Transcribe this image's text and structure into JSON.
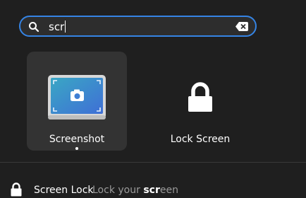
{
  "search": {
    "query": "scr",
    "placeholder": ""
  },
  "apps": [
    {
      "label": "Screenshot",
      "icon": "screenshot-icon",
      "selected": true,
      "running": true
    },
    {
      "label": "Lock Screen",
      "icon": "lock-icon",
      "selected": false,
      "running": false
    }
  ],
  "results": [
    {
      "title": "Screen Lock",
      "description_prefix": "Lock your ",
      "description_match": "scr",
      "description_suffix": "een",
      "icon": "lock-icon"
    }
  ],
  "colors": {
    "accent": "#3584e4",
    "background": "#1f1f1f",
    "tile_selected": "#333333",
    "muted_text": "#9a9a9a"
  }
}
